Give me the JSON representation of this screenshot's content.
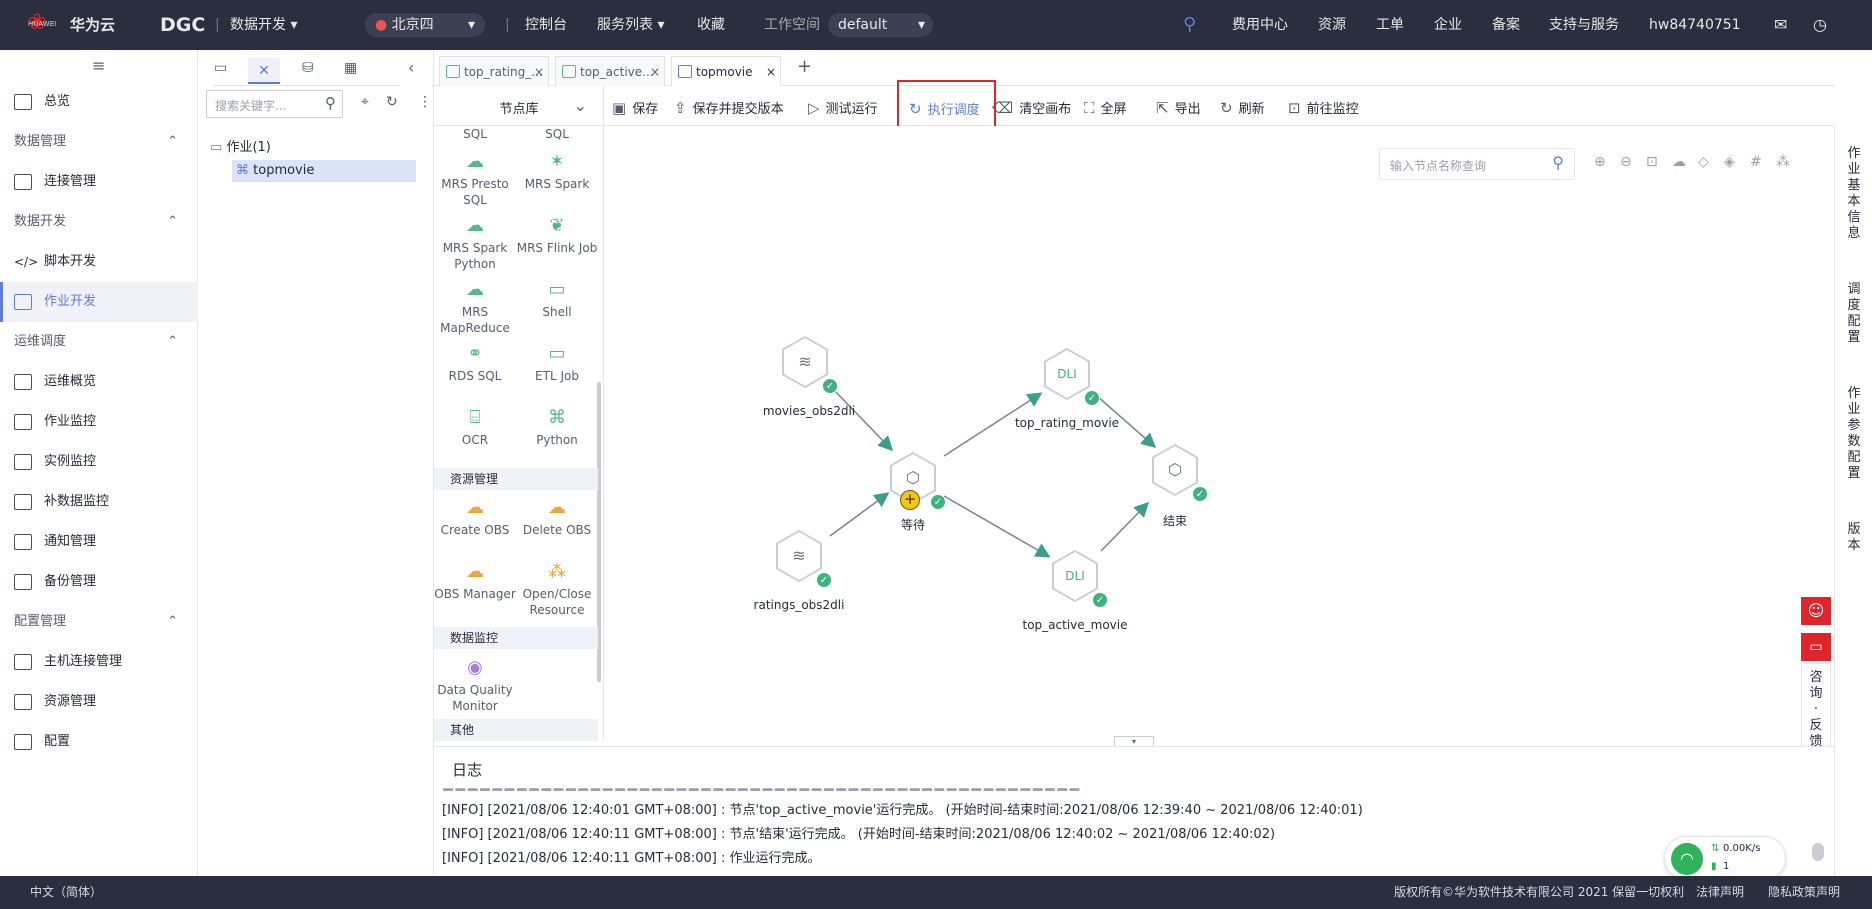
{
  "topbar": {
    "brand": "华为云",
    "brand_sub": "HUAWEI",
    "product": "DGC",
    "module": "数据开发",
    "region": "北京四",
    "console": "控制台",
    "services": "服务列表",
    "favorites": "收藏",
    "workspace_label": "工作空间",
    "workspace_value": "default",
    "billing": "费用中心",
    "resources": "资源",
    "tickets": "工单",
    "enterprise": "企业",
    "icp": "备案",
    "support": "支持与服务",
    "user": "hw84740751"
  },
  "sidebar": {
    "overview": "总览",
    "groups": {
      "data_mgmt": "数据管理",
      "data_dev": "数据开发",
      "ops": "运维调度",
      "config_mgmt": "配置管理"
    },
    "items": {
      "conn_mgmt": "连接管理",
      "script_dev": "脚本开发",
      "job_dev": "作业开发",
      "ops_overview": "运维概览",
      "job_monitor": "作业监控",
      "instance_monitor": "实例监控",
      "patch_monitor": "补数据监控",
      "notify_mgmt": "通知管理",
      "backup_mgmt": "备份管理",
      "host_conn_mgmt": "主机连接管理",
      "resource_mgmt": "资源管理",
      "config": "配置"
    }
  },
  "tree": {
    "search_placeholder": "搜索关键字...",
    "folder": "作业(1)",
    "job": "topmovie"
  },
  "library": {
    "header": "节点库",
    "nodes": {
      "sql1": "SQL",
      "sql2": "SQL",
      "mrs_presto": "MRS Presto SQL",
      "mrs_spark": "MRS Spark",
      "mrs_spark_python": "MRS Spark Python",
      "mrs_flink": "MRS Flink Job",
      "mrs_mapreduce": "MRS MapReduce",
      "shell": "Shell",
      "rds_sql": "RDS SQL",
      "etl_job": "ETL Job",
      "ocr": "OCR",
      "python": "Python",
      "create_obs": "Create OBS",
      "delete_obs": "Delete OBS",
      "obs_manager": "OBS Manager",
      "open_close": "Open/Close Resource",
      "dq_monitor": "Data Quality Monitor"
    },
    "sections": {
      "resource": "资源管理",
      "monitor": "数据监控",
      "other": "其他"
    }
  },
  "tabs": [
    {
      "label": "top_rating_..."
    },
    {
      "label": "top_active..."
    },
    {
      "label": "topmovie"
    }
  ],
  "toolbar": {
    "save": "保存",
    "save_submit": "保存并提交版本",
    "test_run": "测试运行",
    "schedule": "执行调度",
    "clear": "清空画布",
    "fullscreen": "全屏",
    "export": "导出",
    "refresh": "刷新",
    "goto_monitor": "前往监控"
  },
  "canvas": {
    "search_placeholder": "输入节点名称查询",
    "nodes": {
      "movies": "movies_obs2dli",
      "ratings": "ratings_obs2dli",
      "wait": "等待",
      "top_rating": "top_rating_movie",
      "top_active": "top_active_movie",
      "end": "结束"
    }
  },
  "right_panel": {
    "basic": "作业基本信息",
    "schedule": "调度配置",
    "params": "作业参数配置",
    "version": "版本"
  },
  "float": {
    "consult": "咨询·反馈",
    "speed": "0.00K/s",
    "count": "1"
  },
  "log": {
    "title": "日志",
    "lines": [
      "[INFO] [2021/08/06 12:40:01 GMT+08:00] : 节点'top_active_movie'运行完成。 (开始时间-结束时间:2021/08/06 12:39:40 ~ 2021/08/06 12:40:01)",
      "[INFO] [2021/08/06 12:40:11 GMT+08:00] : 节点'结束'运行完成。 (开始时间-结束时间:2021/08/06 12:40:02 ~ 2021/08/06 12:40:02)",
      "[INFO] [2021/08/06 12:40:11 GMT+08:00] : 作业运行完成。"
    ]
  },
  "footer": {
    "lang": "中文（简体）",
    "copyright": "版权所有©华为软件技术有限公司 2021 保留一切权利",
    "legal": "法律声明",
    "privacy": "隐私政策声明"
  }
}
